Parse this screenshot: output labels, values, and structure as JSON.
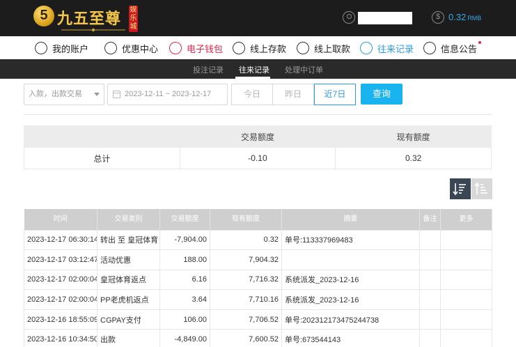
{
  "brand": {
    "logo_mark": "5",
    "name": "九五至尊",
    "tag": "娱乐城"
  },
  "header": {
    "balance_value": "0.32",
    "balance_unit": "RMB"
  },
  "nav": {
    "items": [
      {
        "label": "我的账户",
        "icon": "user-circle-icon"
      },
      {
        "label": "优惠中心",
        "icon": "gift-icon"
      },
      {
        "label": "电子钱包",
        "icon": "wallet-icon"
      },
      {
        "label": "线上存款",
        "icon": "deposit-icon"
      },
      {
        "label": "线上取款",
        "icon": "withdraw-icon"
      },
      {
        "label": "往来记录",
        "icon": "records-icon"
      },
      {
        "label": "信息公告",
        "icon": "bell-icon"
      }
    ]
  },
  "subnav": {
    "tabs": [
      "投注记录",
      "往来记录",
      "处理中订单"
    ],
    "active": "往来记录"
  },
  "filter": {
    "type_placeholder": "入款，出款交易",
    "date_range": "2023-12-11 ~ 2023-12-17",
    "quick": [
      "今日",
      "昨日",
      "近7日"
    ],
    "quick_active": "近7日",
    "search_label": "查询"
  },
  "summary": {
    "headers": [
      "",
      "交易额度",
      "现有额度"
    ],
    "row": [
      "总计",
      "-0.10",
      "0.32"
    ]
  },
  "records": {
    "headers": [
      "时间",
      "交易类别",
      "交易额度",
      "现有额度",
      "摘要",
      "备注",
      "更多"
    ],
    "rows": [
      [
        "2023-12-17 06:30:14",
        "转出 至 皇冠体育",
        "-7,904.00",
        "0.32",
        "单号:113337969483",
        "",
        ""
      ],
      [
        "2023-12-17 03:12:47",
        "活动优惠",
        "188.00",
        "7,904.32",
        "",
        "",
        ""
      ],
      [
        "2023-12-17 02:00:04",
        "皇冠体育返点",
        "6.16",
        "7,716.32",
        "系统派发_2023-12-16",
        "",
        ""
      ],
      [
        "2023-12-17 02:00:04",
        "PP老虎机返点",
        "3.64",
        "7,710.16",
        "系统派发_2023-12-16",
        "",
        ""
      ],
      [
        "2023-12-16 18:55:09",
        "CGPAY支付",
        "106.00",
        "7,706.52",
        "单号:202312173475244738",
        "",
        ""
      ],
      [
        "2023-12-16 10:34:50",
        "出款",
        "-4,849.00",
        "7,600.52",
        "单号:673544143",
        "",
        ""
      ]
    ]
  },
  "colors": {
    "accent_blue": "#19b4f0",
    "active_red": "#e0264c",
    "topbar": "#1c1c1c",
    "gold": "#f3c64a"
  }
}
